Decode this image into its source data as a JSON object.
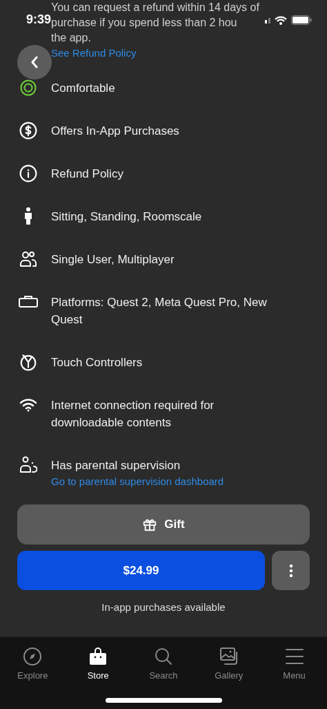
{
  "status_bar": {
    "time": "9:39"
  },
  "refund": {
    "lines": [
      "You can request a refund within 14 days of",
      "purchase if you spend less than 2 hou",
      "the app."
    ],
    "link": "See Refund Policy"
  },
  "features": [
    {
      "kind": "comfort",
      "text": "Comfortable"
    },
    {
      "kind": "purchases",
      "text": "Offers In-App Purchases"
    },
    {
      "kind": "info",
      "text": "Refund Policy"
    },
    {
      "kind": "person",
      "text": "Sitting, Standing, Roomscale"
    },
    {
      "kind": "users",
      "text": "Single User, Multiplayer"
    },
    {
      "kind": "headset",
      "text": "Platforms: Quest 2, Meta Quest Pro, New Quest"
    },
    {
      "kind": "controller",
      "text": "Touch Controllers"
    },
    {
      "kind": "wifi",
      "text": "Internet connection required for downloadable contents"
    },
    {
      "kind": "parental",
      "text": "Has parental supervision",
      "link": "Go to parental supervision dashboard"
    }
  ],
  "gift_button": "Gift",
  "price_button": "$24.99",
  "caption": "In-app purchases available",
  "tabs": [
    {
      "kind": "explore",
      "label": "Explore",
      "selected": false
    },
    {
      "kind": "store",
      "label": "Store",
      "selected": true
    },
    {
      "kind": "search",
      "label": "Search",
      "selected": false
    },
    {
      "kind": "gallery",
      "label": "Gallery",
      "selected": false
    },
    {
      "kind": "menu",
      "label": "Menu",
      "selected": false
    }
  ]
}
